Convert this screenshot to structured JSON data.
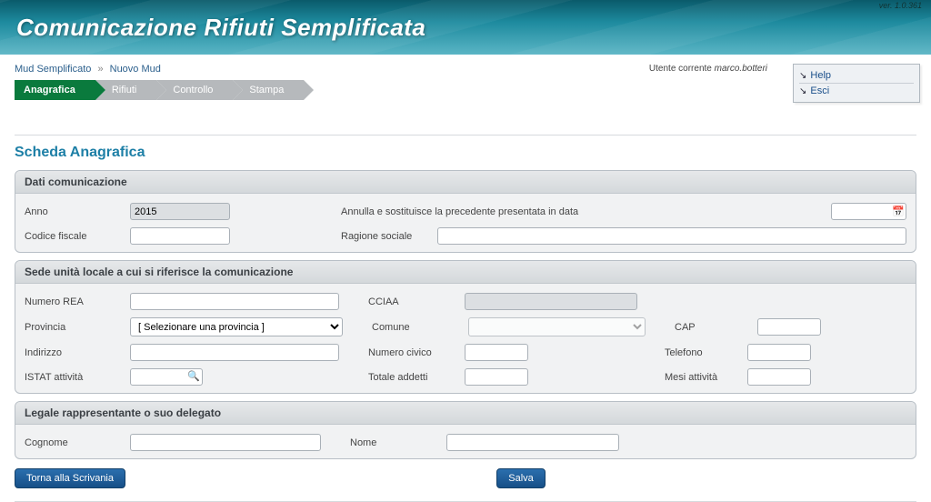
{
  "header": {
    "title": "Comunicazione Rifiuti Semplificata",
    "version": "ver. 1.0.361"
  },
  "breadcrumb": {
    "root": "Mud Semplificato",
    "current": "Nuovo Mud"
  },
  "user": {
    "label": "Utente corrente",
    "name": "marco.botteri"
  },
  "sideLinks": {
    "help": "Help",
    "exit": "Esci"
  },
  "wizard": {
    "step1": "Anagrafica",
    "step2": "Rifiuti",
    "step3": "Controllo",
    "step4": "Stampa"
  },
  "pageTitle": "Scheda Anagrafica",
  "datiComunicazione": {
    "legend": "Dati comunicazione",
    "annoLabel": "Anno",
    "annoValue": "2015",
    "annullaLabel": "Annulla e sostituisce la precedente presentata in data",
    "annullaValue": "",
    "codiceFiscaleLabel": "Codice fiscale",
    "codiceFiscaleValue": "",
    "ragioneSocialeLabel": "Ragione sociale",
    "ragioneSocialeValue": ""
  },
  "sede": {
    "legend": "Sede unità locale a cui si riferisce la comunicazione",
    "numeroReaLabel": "Numero REA",
    "numeroReaValue": "",
    "cciaaLabel": "CCIAA",
    "cciaaValue": "",
    "provinciaLabel": "Provincia",
    "provinciaPlaceholder": "[ Selezionare una provincia ]",
    "comuneLabel": "Comune",
    "comuneValue": "",
    "capLabel": "CAP",
    "capValue": "",
    "indirizzoLabel": "Indirizzo",
    "indirizzoValue": "",
    "numeroCivicoLabel": "Numero civico",
    "numeroCivicoValue": "",
    "telefonoLabel": "Telefono",
    "telefonoValue": "",
    "istatLabel": "ISTAT attività",
    "istatValue": "",
    "totaleAddettiLabel": "Totale addetti",
    "totaleAddettiValue": "",
    "mesiAttivitaLabel": "Mesi attività",
    "mesiAttivitaValue": ""
  },
  "legale": {
    "legend": "Legale rappresentante o suo delegato",
    "cognomeLabel": "Cognome",
    "cognomeValue": "",
    "nomeLabel": "Nome",
    "nomeValue": ""
  },
  "buttons": {
    "back": "Torna alla Scrivania",
    "save": "Salva"
  }
}
